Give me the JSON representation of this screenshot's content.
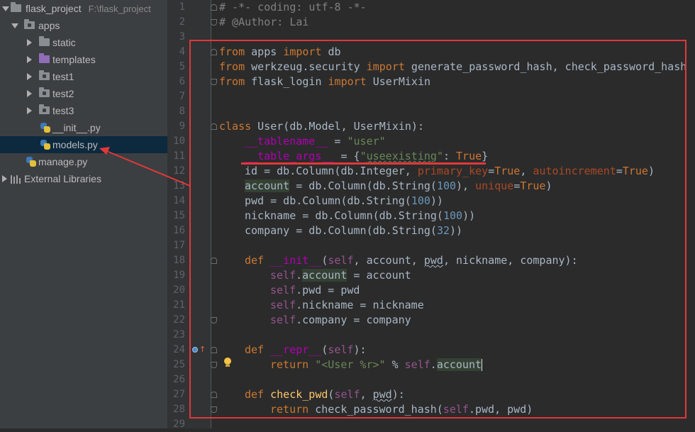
{
  "tree": {
    "project_name": "flask_project",
    "project_path": "F:\\flask_project",
    "apps": "apps",
    "static": "static",
    "templates": "templates",
    "test1": "test1",
    "test2": "test2",
    "test3": "test3",
    "init_file": "__init__.py",
    "models_file": "models.py",
    "manage_file": "manage.py",
    "external_libraries": "External Libraries"
  },
  "editor": {
    "line_numbers": [
      "1",
      "2",
      "3",
      "4",
      "5",
      "6",
      "7",
      "8",
      "9",
      "10",
      "11",
      "12",
      "13",
      "14",
      "15",
      "16",
      "17",
      "18",
      "19",
      "20",
      "21",
      "22",
      "23",
      "24",
      "25",
      "26",
      "27",
      "28",
      "29"
    ],
    "code": {
      "l1": "# -*- coding: utf-8 -*-",
      "l2": "# @Author: Lai",
      "kw_from": "from",
      "kw_import": "import",
      "kw_class": "class",
      "kw_def": "def",
      "kw_return": "return",
      "l4_mod": " apps ",
      "l4_name": " db",
      "l5_mod": " werkzeug.security ",
      "l5_names": " generate_password_hash, check_password_hash",
      "l6_mod": " flask_login ",
      "l6_name": " UserMixin",
      "l9_rest": " User(db.Model, UserMixin):",
      "l10_a": "__tablename__",
      "l10_b": " = ",
      "l10_str": "\"user\"",
      "l11_a": "__table_args__",
      "l11_b": " = {",
      "l11_q1": "\"",
      "l11_key": "useexisting",
      "l11_q2": "\"",
      "l11_c": ": ",
      "l11_true": "True",
      "l11_d": "}",
      "l12_a": "id = db.Column(db.Integer, ",
      "l12_p1": "primary_key",
      "l12_b": "=",
      "l12_t1": "True",
      "l12_c": ", ",
      "l12_p2": "autoincrement",
      "l12_d": "=",
      "l12_t2": "True",
      "l12_e": ")",
      "l13_a": "account",
      "l13_b": " = db.Column(db.String(",
      "l13_n": "100",
      "l13_c": "), ",
      "l13_p": "unique",
      "l13_d": "=",
      "l13_t": "True",
      "l13_e": ")",
      "l14_a": "pwd = db.Column(db.String(",
      "l14_n": "100",
      "l14_b": "))",
      "l15_a": "nickname = db.Column(db.String(",
      "l15_n": "100",
      "l15_b": "))",
      "l16_a": "company = db.Column(db.String(",
      "l16_n": "32",
      "l16_b": "))",
      "l18_fn": "__init__",
      "l18_a": "(",
      "l18_self": "self",
      "l18_b": ", account, ",
      "l18_pwd": "pwd",
      "l18_c": ", nickname, company):",
      "self": "self",
      "l19_a": ".",
      "l19_attr": "account",
      "l19_b": " = account",
      "l20_a": ".pwd = pwd",
      "l21_a": ".nickname = nickname",
      "l22_a": ".company = company",
      "l24_fn": "__repr__",
      "l24_a": "(",
      "l24_b": "):",
      "l25_str": "\"<User %r>\"",
      "l25_a": " % ",
      "l25_b": ".",
      "l25_attr": "account",
      "l27_fn": "check_pwd",
      "l27_a": "(",
      "l27_b": ", ",
      "l27_pwd": "pwd",
      "l27_c": "):",
      "l28_a": " check_password_hash(",
      "l28_b": ".pwd, pwd)"
    }
  },
  "colors": {
    "annotation_red": "#e0383a",
    "keyword": "#cc7832",
    "string": "#6a8759",
    "number": "#6897bb",
    "self": "#94558d",
    "magic": "#b200b2",
    "param": "#aa4926",
    "function": "#ffc66d",
    "selection": "#0d293e"
  }
}
